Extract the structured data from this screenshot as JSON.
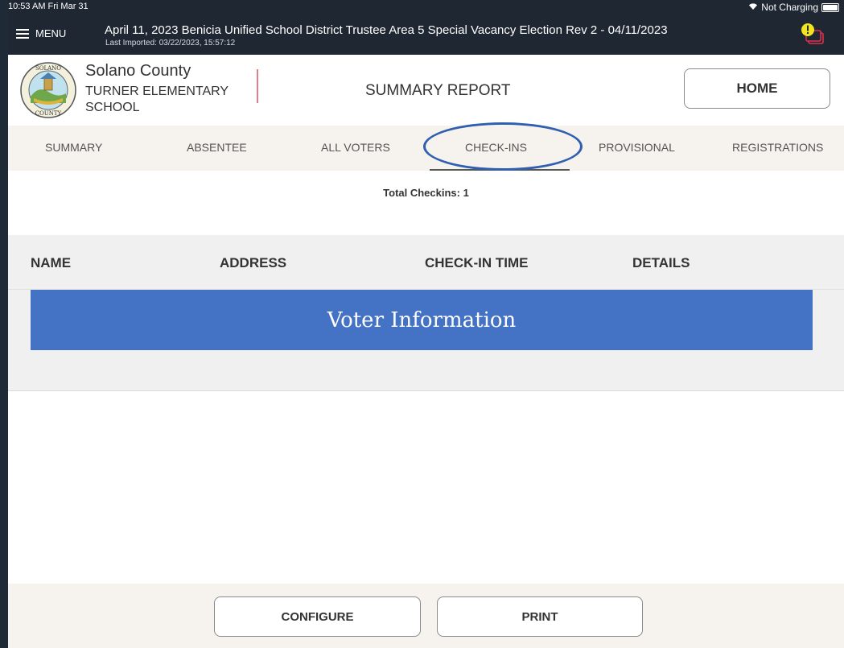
{
  "status_bar": {
    "time": "10:53 AM  Fri Mar 31",
    "charging": "Not Charging"
  },
  "topbar": {
    "menu_label": "MENU",
    "election_title": "April 11, 2023 Benicia Unified School District Trustee Area 5 Special Vacancy Election Rev 2 - 04/11/2023",
    "last_imported": "Last Imported: 03/22/2023, 15:57:12"
  },
  "header": {
    "county": "Solano County",
    "school": "TURNER ELEMENTARY SCHOOL",
    "report_title": "SUMMARY REPORT",
    "home_label": "HOME",
    "seal_text_top": "SOLANO",
    "seal_text_bottom": "COUNTY"
  },
  "tabs": [
    {
      "label": "SUMMARY"
    },
    {
      "label": "ABSENTEE"
    },
    {
      "label": "ALL VOTERS"
    },
    {
      "label": "CHECK-INS",
      "active": true
    },
    {
      "label": "PROVISIONAL"
    },
    {
      "label": "REGISTRATIONS"
    }
  ],
  "summary": {
    "total_checkins": "Total Checkins: 1"
  },
  "table": {
    "columns": [
      "NAME",
      "ADDRESS",
      "CHECK-IN TIME",
      "DETAILS"
    ]
  },
  "banner": {
    "text": "Voter Information"
  },
  "footer": {
    "configure_label": "CONFIGURE",
    "print_label": "PRINT"
  },
  "colors": {
    "topbar": "#1f2733",
    "banner": "#4472c4",
    "tab_highlight": "#2f5fae",
    "divider": "#e47c86"
  },
  "icons": [
    "menu-icon",
    "wifi-icon",
    "battery-icon",
    "alert-icon",
    "county-seal"
  ]
}
